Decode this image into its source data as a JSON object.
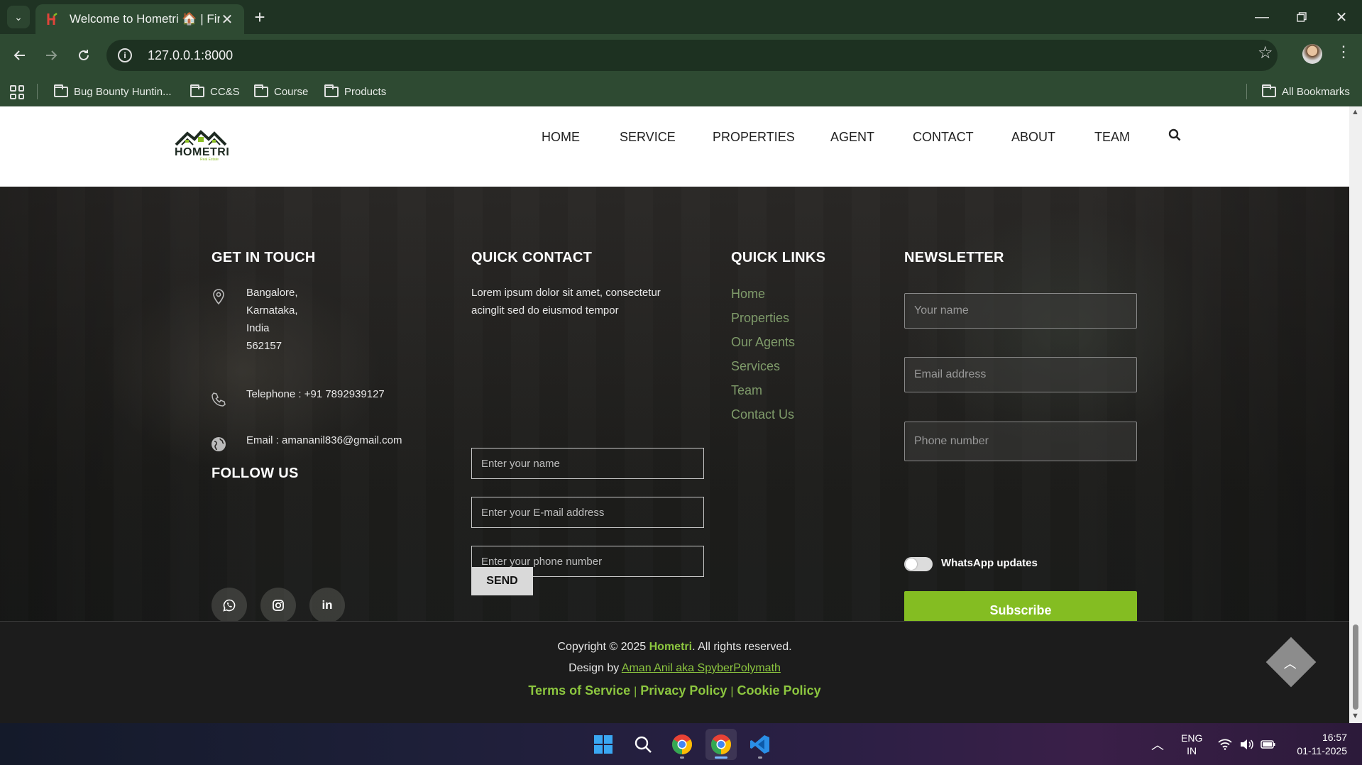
{
  "browser": {
    "tab_title": "Welcome to Hometri 🏠 | Find",
    "url": "127.0.0.1:8000",
    "bookmarks": [
      "Bug Bounty Huntin...",
      "CC&S",
      "Course",
      "Products"
    ],
    "all_bookmarks": "All Bookmarks"
  },
  "site": {
    "logo_text": "HOMETRI",
    "logo_tagline": "Real Estate",
    "nav": [
      "HOME",
      "SERVICE",
      "PROPERTIES",
      "AGENT",
      "CONTACT",
      "ABOUT",
      "TEAM"
    ]
  },
  "footer": {
    "get_in_touch": {
      "heading": "GET IN TOUCH",
      "address_lines": [
        "Bangalore,",
        "Karnataka,",
        "India",
        "562157"
      ],
      "telephone": "Telephone : +91 7892939127",
      "email": "Email : amananil836@gmail.com"
    },
    "follow_us": {
      "heading": "FOLLOW US"
    },
    "quick_contact": {
      "heading": "QUICK CONTACT",
      "text_line1": "Lorem ipsum dolor sit amet, consectetur",
      "text_line2": "acinglit sed do eiusmod tempor",
      "name_placeholder": "Enter your name",
      "email_placeholder": "Enter your E-mail address",
      "phone_placeholder": "Enter your phone number",
      "send_label": "SEND"
    },
    "quick_links": {
      "heading": "QUICK LINKS",
      "links": [
        "Home",
        "Properties",
        "Our Agents",
        "Services",
        "Team",
        "Contact Us"
      ]
    },
    "newsletter": {
      "heading": "NEWSLETTER",
      "name_placeholder": "Your name",
      "email_placeholder": "Email address",
      "phone_placeholder": "Phone number",
      "whatsapp_label": "WhatsApp updates",
      "subscribe_label": "Subscribe"
    }
  },
  "copyright": {
    "prefix": "Copyright © 2025 ",
    "brand": "Hometri",
    "suffix": ". All rights reserved.",
    "design_prefix": "Design by ",
    "design_link": "Aman Anil aka SpyberPolymath",
    "terms": "Terms of Service",
    "privacy": "Privacy Policy",
    "cookie": "Cookie Policy"
  },
  "taskbar": {
    "lang_top": "ENG",
    "lang_bottom": "IN",
    "time": "16:57",
    "date": "01-11-2025"
  },
  "colors": {
    "accent_green": "#84bd22",
    "chrome_green": "#2e4a32"
  }
}
